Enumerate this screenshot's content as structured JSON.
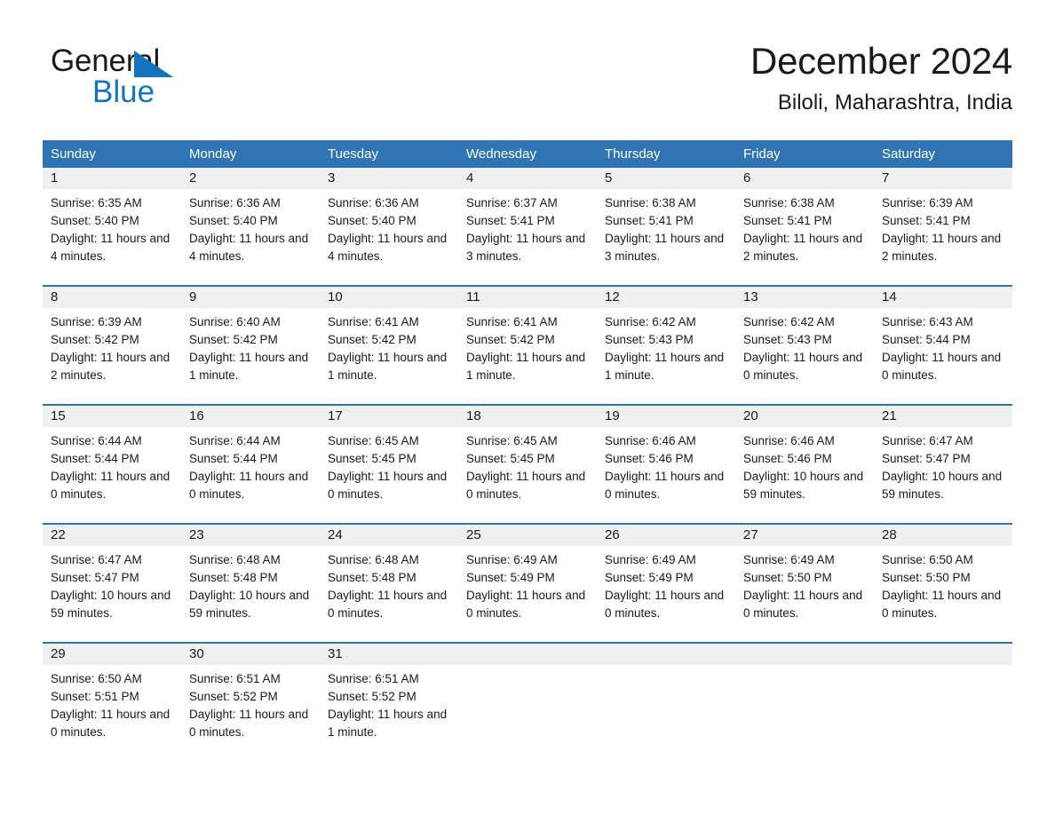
{
  "brand": {
    "name_part1": "General",
    "name_part2": "Blue",
    "accent_color": "#1574bd",
    "logo_icon": "triangle-flag-icon"
  },
  "header": {
    "title": "December 2024",
    "subtitle": "Biloli, Maharashtra, India"
  },
  "theme": {
    "header_blue": "#2f74b5",
    "daynum_gray": "#f0f0f0",
    "text_color": "#1a1a1a"
  },
  "weekdays": [
    "Sunday",
    "Monday",
    "Tuesday",
    "Wednesday",
    "Thursday",
    "Friday",
    "Saturday"
  ],
  "weeks": [
    {
      "days": [
        {
          "num": "1",
          "sunrise": "Sunrise: 6:35 AM",
          "sunset": "Sunset: 5:40 PM",
          "daylight": "Daylight: 11 hours and 4 minutes."
        },
        {
          "num": "2",
          "sunrise": "Sunrise: 6:36 AM",
          "sunset": "Sunset: 5:40 PM",
          "daylight": "Daylight: 11 hours and 4 minutes."
        },
        {
          "num": "3",
          "sunrise": "Sunrise: 6:36 AM",
          "sunset": "Sunset: 5:40 PM",
          "daylight": "Daylight: 11 hours and 4 minutes."
        },
        {
          "num": "4",
          "sunrise": "Sunrise: 6:37 AM",
          "sunset": "Sunset: 5:41 PM",
          "daylight": "Daylight: 11 hours and 3 minutes."
        },
        {
          "num": "5",
          "sunrise": "Sunrise: 6:38 AM",
          "sunset": "Sunset: 5:41 PM",
          "daylight": "Daylight: 11 hours and 3 minutes."
        },
        {
          "num": "6",
          "sunrise": "Sunrise: 6:38 AM",
          "sunset": "Sunset: 5:41 PM",
          "daylight": "Daylight: 11 hours and 2 minutes."
        },
        {
          "num": "7",
          "sunrise": "Sunrise: 6:39 AM",
          "sunset": "Sunset: 5:41 PM",
          "daylight": "Daylight: 11 hours and 2 minutes."
        }
      ]
    },
    {
      "days": [
        {
          "num": "8",
          "sunrise": "Sunrise: 6:39 AM",
          "sunset": "Sunset: 5:42 PM",
          "daylight": "Daylight: 11 hours and 2 minutes."
        },
        {
          "num": "9",
          "sunrise": "Sunrise: 6:40 AM",
          "sunset": "Sunset: 5:42 PM",
          "daylight": "Daylight: 11 hours and 1 minute."
        },
        {
          "num": "10",
          "sunrise": "Sunrise: 6:41 AM",
          "sunset": "Sunset: 5:42 PM",
          "daylight": "Daylight: 11 hours and 1 minute."
        },
        {
          "num": "11",
          "sunrise": "Sunrise: 6:41 AM",
          "sunset": "Sunset: 5:42 PM",
          "daylight": "Daylight: 11 hours and 1 minute."
        },
        {
          "num": "12",
          "sunrise": "Sunrise: 6:42 AM",
          "sunset": "Sunset: 5:43 PM",
          "daylight": "Daylight: 11 hours and 1 minute."
        },
        {
          "num": "13",
          "sunrise": "Sunrise: 6:42 AM",
          "sunset": "Sunset: 5:43 PM",
          "daylight": "Daylight: 11 hours and 0 minutes."
        },
        {
          "num": "14",
          "sunrise": "Sunrise: 6:43 AM",
          "sunset": "Sunset: 5:44 PM",
          "daylight": "Daylight: 11 hours and 0 minutes."
        }
      ]
    },
    {
      "days": [
        {
          "num": "15",
          "sunrise": "Sunrise: 6:44 AM",
          "sunset": "Sunset: 5:44 PM",
          "daylight": "Daylight: 11 hours and 0 minutes."
        },
        {
          "num": "16",
          "sunrise": "Sunrise: 6:44 AM",
          "sunset": "Sunset: 5:44 PM",
          "daylight": "Daylight: 11 hours and 0 minutes."
        },
        {
          "num": "17",
          "sunrise": "Sunrise: 6:45 AM",
          "sunset": "Sunset: 5:45 PM",
          "daylight": "Daylight: 11 hours and 0 minutes."
        },
        {
          "num": "18",
          "sunrise": "Sunrise: 6:45 AM",
          "sunset": "Sunset: 5:45 PM",
          "daylight": "Daylight: 11 hours and 0 minutes."
        },
        {
          "num": "19",
          "sunrise": "Sunrise: 6:46 AM",
          "sunset": "Sunset: 5:46 PM",
          "daylight": "Daylight: 11 hours and 0 minutes."
        },
        {
          "num": "20",
          "sunrise": "Sunrise: 6:46 AM",
          "sunset": "Sunset: 5:46 PM",
          "daylight": "Daylight: 10 hours and 59 minutes."
        },
        {
          "num": "21",
          "sunrise": "Sunrise: 6:47 AM",
          "sunset": "Sunset: 5:47 PM",
          "daylight": "Daylight: 10 hours and 59 minutes."
        }
      ]
    },
    {
      "days": [
        {
          "num": "22",
          "sunrise": "Sunrise: 6:47 AM",
          "sunset": "Sunset: 5:47 PM",
          "daylight": "Daylight: 10 hours and 59 minutes."
        },
        {
          "num": "23",
          "sunrise": "Sunrise: 6:48 AM",
          "sunset": "Sunset: 5:48 PM",
          "daylight": "Daylight: 10 hours and 59 minutes."
        },
        {
          "num": "24",
          "sunrise": "Sunrise: 6:48 AM",
          "sunset": "Sunset: 5:48 PM",
          "daylight": "Daylight: 11 hours and 0 minutes."
        },
        {
          "num": "25",
          "sunrise": "Sunrise: 6:49 AM",
          "sunset": "Sunset: 5:49 PM",
          "daylight": "Daylight: 11 hours and 0 minutes."
        },
        {
          "num": "26",
          "sunrise": "Sunrise: 6:49 AM",
          "sunset": "Sunset: 5:49 PM",
          "daylight": "Daylight: 11 hours and 0 minutes."
        },
        {
          "num": "27",
          "sunrise": "Sunrise: 6:49 AM",
          "sunset": "Sunset: 5:50 PM",
          "daylight": "Daylight: 11 hours and 0 minutes."
        },
        {
          "num": "28",
          "sunrise": "Sunrise: 6:50 AM",
          "sunset": "Sunset: 5:50 PM",
          "daylight": "Daylight: 11 hours and 0 minutes."
        }
      ]
    },
    {
      "days": [
        {
          "num": "29",
          "sunrise": "Sunrise: 6:50 AM",
          "sunset": "Sunset: 5:51 PM",
          "daylight": "Daylight: 11 hours and 0 minutes."
        },
        {
          "num": "30",
          "sunrise": "Sunrise: 6:51 AM",
          "sunset": "Sunset: 5:52 PM",
          "daylight": "Daylight: 11 hours and 0 minutes."
        },
        {
          "num": "31",
          "sunrise": "Sunrise: 6:51 AM",
          "sunset": "Sunset: 5:52 PM",
          "daylight": "Daylight: 11 hours and 1 minute."
        },
        {
          "num": "",
          "sunrise": "",
          "sunset": "",
          "daylight": ""
        },
        {
          "num": "",
          "sunrise": "",
          "sunset": "",
          "daylight": ""
        },
        {
          "num": "",
          "sunrise": "",
          "sunset": "",
          "daylight": ""
        },
        {
          "num": "",
          "sunrise": "",
          "sunset": "",
          "daylight": ""
        }
      ]
    }
  ]
}
